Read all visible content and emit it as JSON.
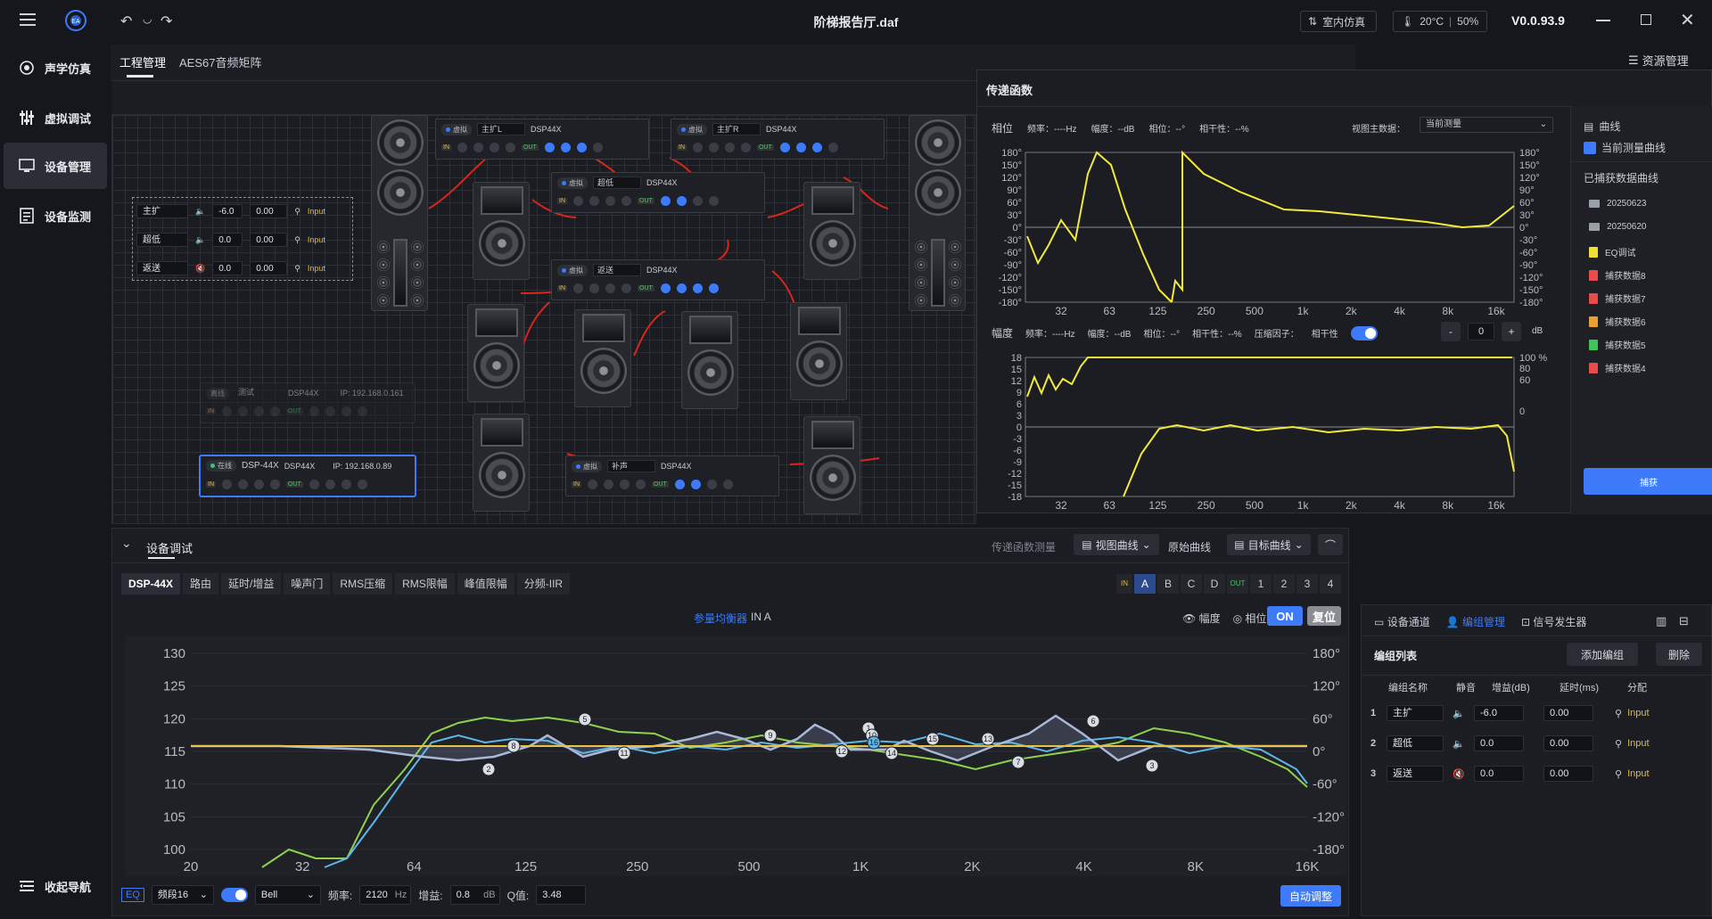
{
  "app": {
    "title": "阶梯报告厅.daf",
    "version": "V0.0.93.9",
    "env_mode": "室内仿真",
    "temperature": "20°C",
    "humidity": "50%"
  },
  "sidebar": {
    "items": [
      {
        "label": "声学仿真",
        "icon": "sound-sim-icon"
      },
      {
        "label": "虚拟调试",
        "icon": "sliders-icon"
      },
      {
        "label": "设备管理",
        "icon": "device-icon"
      },
      {
        "label": "设备监测",
        "icon": "monitor-icon"
      }
    ],
    "collapse_label": "收起导航"
  },
  "project_tabs": [
    "工程管理",
    "AES67音频矩阵"
  ],
  "resource_label": "资源管理",
  "canvas": {
    "channels": [
      {
        "name": "主扩",
        "gain": "-6.0",
        "delay": "0.00",
        "route": "Input",
        "muted": false
      },
      {
        "name": "超低",
        "gain": "0.0",
        "delay": "0.00",
        "route": "Input",
        "muted": false
      },
      {
        "name": "返送",
        "gain": "0.0",
        "delay": "0.00",
        "route": "Input",
        "muted": true
      }
    ],
    "devices": [
      {
        "status": "虚拟",
        "name": "主扩L",
        "model": "DSP44X",
        "ip": ""
      },
      {
        "status": "虚拟",
        "name": "主扩R",
        "model": "DSP44X",
        "ip": ""
      },
      {
        "status": "虚拟",
        "name": "超低",
        "model": "DSP44X",
        "ip": ""
      },
      {
        "status": "虚拟",
        "name": "返送",
        "model": "DSP44X",
        "ip": ""
      },
      {
        "status": "离线",
        "name": "测试",
        "model": "DSP44X",
        "ip": "IP: 192.168.0.161"
      },
      {
        "status": "在线",
        "name": "DSP-44X",
        "model": "DSP44X",
        "ip": "IP: 192.168.0.89"
      },
      {
        "status": "虚拟",
        "name": "补声",
        "model": "DSP44X",
        "ip": ""
      }
    ]
  },
  "transfer": {
    "title": "传递函数",
    "phase_label": "相位",
    "mag_label": "幅度",
    "freq_readout": "频率：----Hz",
    "amp_readout": "幅度：--dB",
    "phase_readout": "相位：--°",
    "coherence_readout": "相干性：--%",
    "view_main_label": "视图主数据：",
    "view_main_value": "当前测量",
    "compress_label": "压缩因子：",
    "coherence_label": "相干性",
    "compress_value": "0",
    "minus": "-",
    "plus": "+",
    "db_unit": "dB",
    "phase_ticks": [
      "180°",
      "150°",
      "120°",
      "90°",
      "60°",
      "30°",
      "0°",
      "-30°",
      "-60°",
      "-90°",
      "-120°",
      "-150°",
      "-180°"
    ],
    "mag_ticks": [
      "18",
      "15",
      "12",
      "9",
      "6",
      "3",
      "0",
      "-3",
      "-6",
      "-9",
      "-12",
      "-15",
      "-18"
    ],
    "mag_right_ticks": [
      "100 %",
      "80",
      "60",
      "0"
    ],
    "freq_ticks": [
      "32",
      "63",
      "125",
      "250",
      "500",
      "1k",
      "2k",
      "4k",
      "8k",
      "16k"
    ]
  },
  "curves": {
    "header": "曲线",
    "current": "当前测量曲线",
    "captured": "已捕获数据曲线",
    "items": [
      {
        "name": "20250623",
        "type": "folder",
        "color": "#9aa0a8"
      },
      {
        "name": "20250620",
        "type": "folder",
        "color": "#9aa0a8"
      },
      {
        "name": "EQ调试",
        "type": "file",
        "color": "#f0e030"
      },
      {
        "name": "捕获数据8",
        "type": "file",
        "color": "#e94a4a"
      },
      {
        "name": "捕获数据7",
        "type": "file",
        "color": "#e94a4a"
      },
      {
        "name": "捕获数据6",
        "type": "file",
        "color": "#e8a030"
      },
      {
        "name": "捕获数据5",
        "type": "file",
        "color": "#3fc45a"
      },
      {
        "name": "捕获数据4",
        "type": "file",
        "color": "#e94a4a"
      }
    ],
    "capture_btn": "捕获"
  },
  "debug": {
    "title": "设备调试",
    "toolbar": {
      "transfer_measure": "传递函数测量",
      "view_curve": "视图曲线",
      "raw_curve": "原始曲线",
      "target_curve": "目标曲线"
    },
    "tabs": [
      "DSP-44X",
      "路由",
      "延时/增益",
      "噪声门",
      "RMS压缩",
      "RMS限幅",
      "峰值限幅",
      "分频-IIR"
    ],
    "in_label": "IN",
    "in_channels": [
      "A",
      "B",
      "C",
      "D"
    ],
    "out_label": "OUT",
    "out_channels": [
      "1",
      "2",
      "3",
      "4"
    ],
    "eq_title": "参量均衡器",
    "eq_channel": "IN A",
    "show_amp": "幅度",
    "show_phase": "相位",
    "on_btn": "ON",
    "reset_btn": "复位",
    "y_left": [
      "130",
      "125",
      "120",
      "115",
      "110",
      "105",
      "100"
    ],
    "y_right": [
      "180°",
      "120°",
      "60°",
      "0°",
      "-60°",
      "-120°",
      "-180°"
    ],
    "x_ticks": [
      "20",
      "32",
      "64",
      "125",
      "250",
      "500",
      "1K",
      "2K",
      "4K",
      "8K",
      "16K"
    ],
    "eq_tag": "EQ",
    "band_value": "频段16",
    "filter_type": "Bell",
    "freq_label": "频率:",
    "freq_value": "2120",
    "freq_unit": "Hz",
    "gain_label": "增益:",
    "gain_value": "0.8",
    "gain_unit": "dB",
    "q_label": "Q值:",
    "q_value": "3.48",
    "auto_btn": "自动调整"
  },
  "groups": {
    "tabs": [
      "设备通道",
      "编组管理",
      "信号发生器"
    ],
    "list_title": "编组列表",
    "add_btn": "添加编组",
    "delete_btn": "删除",
    "columns": [
      "编组名称",
      "静音",
      "增益(dB)",
      "延时(ms)",
      "分配"
    ],
    "rows": [
      {
        "index": "1",
        "name": "主扩",
        "gain": "-6.0",
        "delay": "0.00",
        "route": "Input",
        "muted": false
      },
      {
        "index": "2",
        "name": "超低",
        "gain": "0.0",
        "delay": "0.00",
        "route": "Input",
        "muted": false
      },
      {
        "index": "3",
        "name": "返送",
        "gain": "0.0",
        "delay": "0.00",
        "route": "Input",
        "muted": true
      }
    ]
  },
  "colors": {
    "accent": "#3d7bfa",
    "curve_yellow": "#f2ea3a",
    "eq_green": "#8fd14f",
    "eq_blue": "#5fb6e8",
    "eq_sum": "#a9b8d8"
  }
}
